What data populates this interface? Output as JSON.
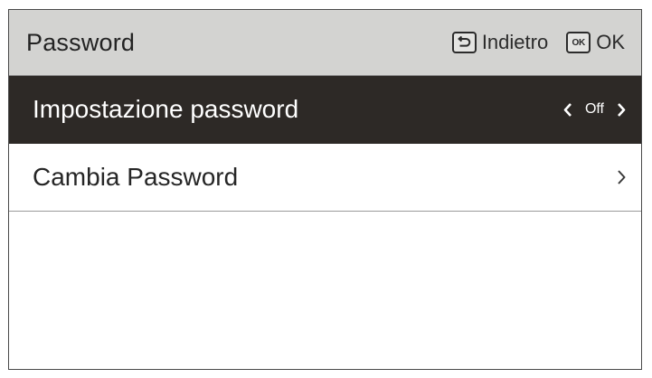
{
  "header": {
    "title": "Password",
    "back_label": "Indietro",
    "back_icon": "back-return-icon",
    "ok_glyph": "OK",
    "ok_label": "OK",
    "ok_icon": "ok-key-icon"
  },
  "menu": {
    "items": [
      {
        "label": "Impostazione password",
        "value": "Off",
        "selected": true,
        "control": "left-right-selector"
      },
      {
        "label": "Cambia Password",
        "selected": false,
        "control": "chevron-right"
      }
    ]
  },
  "colors": {
    "header_bg": "#d3d3d1",
    "selected_bg": "#2d2926",
    "text": "#232323"
  }
}
